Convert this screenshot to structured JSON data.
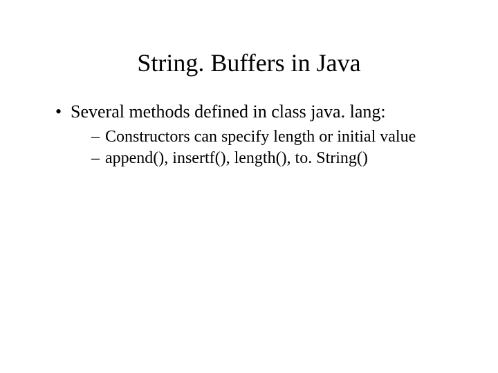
{
  "slide": {
    "title": "String. Buffers in Java",
    "bullets": [
      {
        "text": "Several methods defined in class java. lang:",
        "subitems": [
          "Constructors can specify length or initial value",
          "append(), insertf(), length(), to. String()"
        ]
      }
    ]
  }
}
